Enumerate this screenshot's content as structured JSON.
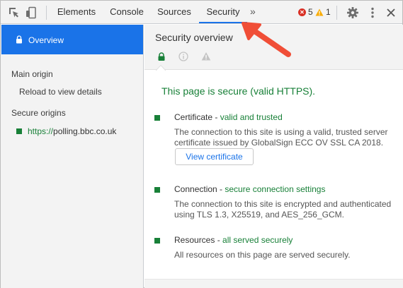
{
  "toolbar": {
    "tabs": [
      {
        "label": "Elements"
      },
      {
        "label": "Console"
      },
      {
        "label": "Sources"
      },
      {
        "label": "Security"
      }
    ],
    "more_label": "»",
    "errors_count": "5",
    "warnings_count": "1",
    "close_label": "✕",
    "icons": [
      "inspect-element-icon",
      "device-toolbar-icon",
      "error-icon",
      "warning-icon",
      "settings-gear-icon",
      "more-options-icon",
      "close-icon"
    ],
    "colors": {
      "accent": "#1a73e8",
      "error": "#d93025",
      "warning": "#f9ab00"
    }
  },
  "sidebar": {
    "overview_label": "Overview",
    "main_origin_heading": "Main origin",
    "reload_label": "Reload to view details",
    "secure_origins_heading": "Secure origins",
    "origin_scheme": "https://",
    "origin_host": "polling.bbc.co.uk"
  },
  "main": {
    "title": "Security overview",
    "status": "This page is secure (valid HTTPS).",
    "certificate": {
      "label": "Certificate - ",
      "value": "valid and trusted",
      "description": "The connection to this site is using a valid, trusted server certificate issued by GlobalSign ECC OV SSL CA 2018.",
      "button": "View certificate"
    },
    "connection": {
      "label": "Connection - ",
      "value": "secure connection settings",
      "description": "The connection to this site is encrypted and authenticated using TLS 1.3, X25519, and AES_256_GCM."
    },
    "resources": {
      "label": "Resources - ",
      "value": "all served securely",
      "description": "All resources on this page are served securely."
    },
    "colors": {
      "secure": "#188038"
    }
  },
  "annotation": {
    "color": "#f04e37"
  }
}
